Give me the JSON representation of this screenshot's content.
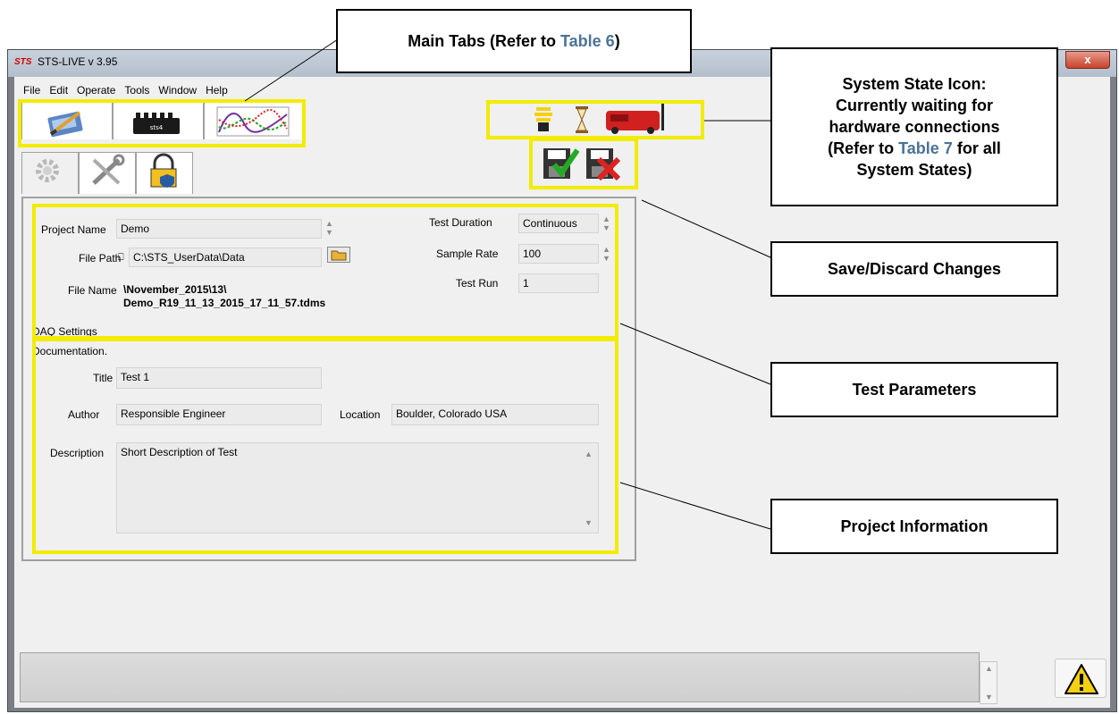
{
  "window": {
    "app_logo": "STS",
    "title": "STS-LIVE v 3.95",
    "close_label": "x"
  },
  "menu": [
    "File",
    "Edit",
    "Operate",
    "Tools",
    "Window",
    "Help"
  ],
  "main_tabs": [
    "configuration-tab-icon",
    "hardware-tab-icon",
    "graph-tab-icon"
  ],
  "sub_tabs": [
    "settings-gear-icon",
    "tools-icon",
    "lock-icon"
  ],
  "state_icons": [
    "bulb-icon",
    "hourglass-icon",
    "hardware-device-icon"
  ],
  "action_icons": [
    "save-icon",
    "discard-icon"
  ],
  "test_params": {
    "project_name_label": "Project Name",
    "project_name": "Demo",
    "file_path_label": "File Path",
    "file_path": "C:\\STS_UserData\\Data",
    "file_name_label": "File Name",
    "file_name_line1": "\\November_2015\\13\\",
    "file_name_line2": "Demo_R19_11_13_2015_17_11_57.tdms",
    "test_duration_label": "Test Duration",
    "test_duration": "Continuous",
    "sample_rate_label": "Sample Rate",
    "sample_rate": "100",
    "test_run_label": "Test Run",
    "test_run": "1",
    "daq_settings": "DAQ Settings"
  },
  "project_info": {
    "documentation_label": "Documentation.",
    "title_label": "Title",
    "title": "Test 1",
    "author_label": "Author",
    "author": "Responsible Engineer",
    "location_label": "Location",
    "location": "Boulder, Colorado USA",
    "description_label": "Description",
    "description": "Short Description of Test"
  },
  "callouts": {
    "main_tabs_pre": "Main Tabs (Refer to ",
    "main_tabs_ref": "Table 6",
    "main_tabs_post": ")",
    "state_line1": "System State Icon:",
    "state_line2": "Currently waiting for",
    "state_line3": "hardware connections",
    "state_line4_pre": "(Refer to ",
    "state_line4_ref": "Table 7",
    "state_line4_post": " for all",
    "state_line5": "System States)",
    "save_discard": "Save/Discard Changes",
    "test_parameters": "Test Parameters",
    "project_information": "Project Information"
  },
  "colors": {
    "highlight": "#f2ec00",
    "reference_link": "#4a7396",
    "window_bg": "#f0f0f0"
  }
}
